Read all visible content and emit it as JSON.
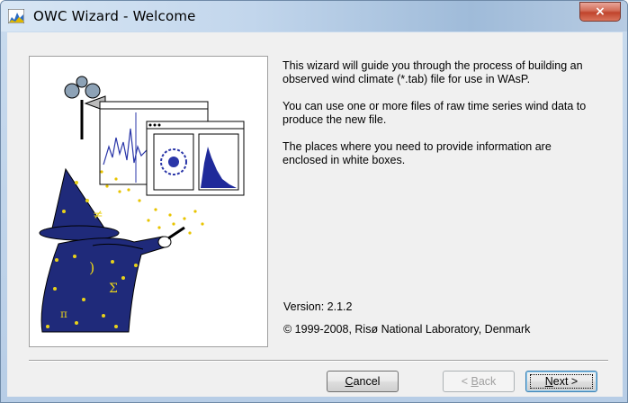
{
  "window": {
    "title": "OWC Wizard - Welcome",
    "icon": "wasp-chart-icon",
    "close_label": "×"
  },
  "intro": {
    "paragraph1": "This wizard will guide you through the process of building an observed wind climate (*.tab) file for use in WAsP.",
    "paragraph2": "You can use one or more files of raw time series wind data to produce the new file.",
    "paragraph3": "The places where you need to provide information are enclosed in white boxes."
  },
  "footer_info": {
    "version": "Version: 2.1.2",
    "copyright": "© 1999-2008, Risø National Laboratory, Denmark"
  },
  "buttons": {
    "cancel": {
      "prefix": "",
      "accel": "C",
      "rest": "ancel",
      "enabled": true
    },
    "back": {
      "prefix": "< ",
      "accel": "B",
      "rest": "ack",
      "enabled": false
    },
    "next": {
      "prefix": "",
      "accel": "N",
      "rest": "ext >",
      "enabled": true,
      "default": true
    }
  },
  "colors": {
    "titlebar": "#c2d6ec",
    "close_button": "#c0432b",
    "dialog_bg": "#f0f0f0",
    "wizard_robe": "#1f2a7a",
    "stars": "#e8d21a"
  }
}
